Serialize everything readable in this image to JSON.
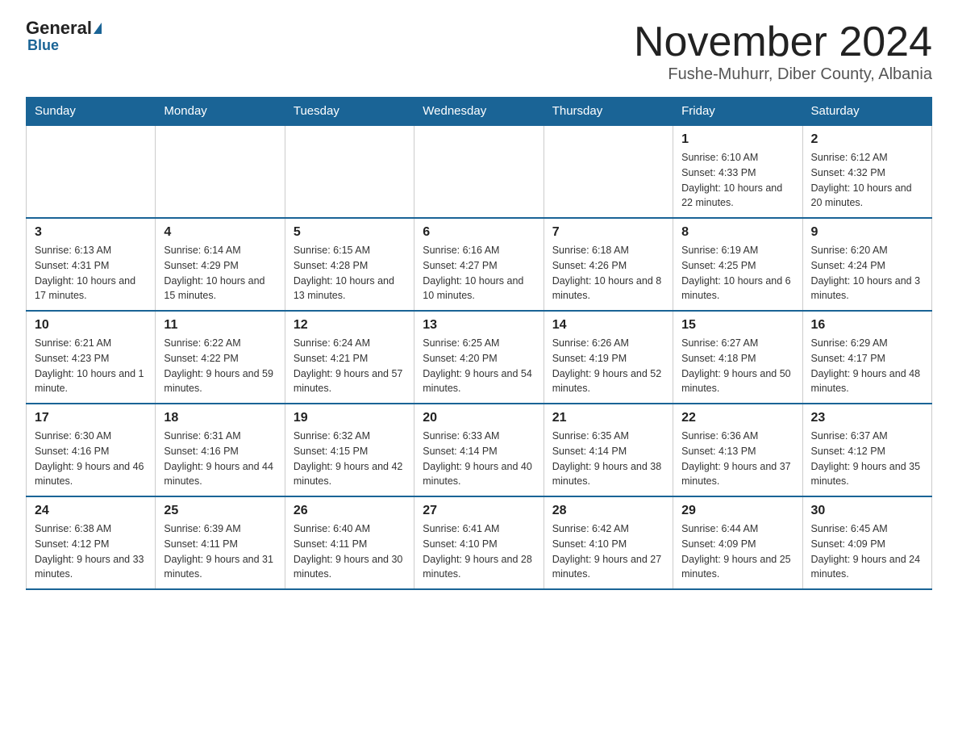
{
  "logo": {
    "general": "General",
    "blue": "Blue"
  },
  "header": {
    "month": "November 2024",
    "location": "Fushe-Muhurr, Diber County, Albania"
  },
  "weekdays": [
    "Sunday",
    "Monday",
    "Tuesday",
    "Wednesday",
    "Thursday",
    "Friday",
    "Saturday"
  ],
  "weeks": [
    [
      {
        "day": "",
        "info": ""
      },
      {
        "day": "",
        "info": ""
      },
      {
        "day": "",
        "info": ""
      },
      {
        "day": "",
        "info": ""
      },
      {
        "day": "",
        "info": ""
      },
      {
        "day": "1",
        "info": "Sunrise: 6:10 AM\nSunset: 4:33 PM\nDaylight: 10 hours and 22 minutes."
      },
      {
        "day": "2",
        "info": "Sunrise: 6:12 AM\nSunset: 4:32 PM\nDaylight: 10 hours and 20 minutes."
      }
    ],
    [
      {
        "day": "3",
        "info": "Sunrise: 6:13 AM\nSunset: 4:31 PM\nDaylight: 10 hours and 17 minutes."
      },
      {
        "day": "4",
        "info": "Sunrise: 6:14 AM\nSunset: 4:29 PM\nDaylight: 10 hours and 15 minutes."
      },
      {
        "day": "5",
        "info": "Sunrise: 6:15 AM\nSunset: 4:28 PM\nDaylight: 10 hours and 13 minutes."
      },
      {
        "day": "6",
        "info": "Sunrise: 6:16 AM\nSunset: 4:27 PM\nDaylight: 10 hours and 10 minutes."
      },
      {
        "day": "7",
        "info": "Sunrise: 6:18 AM\nSunset: 4:26 PM\nDaylight: 10 hours and 8 minutes."
      },
      {
        "day": "8",
        "info": "Sunrise: 6:19 AM\nSunset: 4:25 PM\nDaylight: 10 hours and 6 minutes."
      },
      {
        "day": "9",
        "info": "Sunrise: 6:20 AM\nSunset: 4:24 PM\nDaylight: 10 hours and 3 minutes."
      }
    ],
    [
      {
        "day": "10",
        "info": "Sunrise: 6:21 AM\nSunset: 4:23 PM\nDaylight: 10 hours and 1 minute."
      },
      {
        "day": "11",
        "info": "Sunrise: 6:22 AM\nSunset: 4:22 PM\nDaylight: 9 hours and 59 minutes."
      },
      {
        "day": "12",
        "info": "Sunrise: 6:24 AM\nSunset: 4:21 PM\nDaylight: 9 hours and 57 minutes."
      },
      {
        "day": "13",
        "info": "Sunrise: 6:25 AM\nSunset: 4:20 PM\nDaylight: 9 hours and 54 minutes."
      },
      {
        "day": "14",
        "info": "Sunrise: 6:26 AM\nSunset: 4:19 PM\nDaylight: 9 hours and 52 minutes."
      },
      {
        "day": "15",
        "info": "Sunrise: 6:27 AM\nSunset: 4:18 PM\nDaylight: 9 hours and 50 minutes."
      },
      {
        "day": "16",
        "info": "Sunrise: 6:29 AM\nSunset: 4:17 PM\nDaylight: 9 hours and 48 minutes."
      }
    ],
    [
      {
        "day": "17",
        "info": "Sunrise: 6:30 AM\nSunset: 4:16 PM\nDaylight: 9 hours and 46 minutes."
      },
      {
        "day": "18",
        "info": "Sunrise: 6:31 AM\nSunset: 4:16 PM\nDaylight: 9 hours and 44 minutes."
      },
      {
        "day": "19",
        "info": "Sunrise: 6:32 AM\nSunset: 4:15 PM\nDaylight: 9 hours and 42 minutes."
      },
      {
        "day": "20",
        "info": "Sunrise: 6:33 AM\nSunset: 4:14 PM\nDaylight: 9 hours and 40 minutes."
      },
      {
        "day": "21",
        "info": "Sunrise: 6:35 AM\nSunset: 4:14 PM\nDaylight: 9 hours and 38 minutes."
      },
      {
        "day": "22",
        "info": "Sunrise: 6:36 AM\nSunset: 4:13 PM\nDaylight: 9 hours and 37 minutes."
      },
      {
        "day": "23",
        "info": "Sunrise: 6:37 AM\nSunset: 4:12 PM\nDaylight: 9 hours and 35 minutes."
      }
    ],
    [
      {
        "day": "24",
        "info": "Sunrise: 6:38 AM\nSunset: 4:12 PM\nDaylight: 9 hours and 33 minutes."
      },
      {
        "day": "25",
        "info": "Sunrise: 6:39 AM\nSunset: 4:11 PM\nDaylight: 9 hours and 31 minutes."
      },
      {
        "day": "26",
        "info": "Sunrise: 6:40 AM\nSunset: 4:11 PM\nDaylight: 9 hours and 30 minutes."
      },
      {
        "day": "27",
        "info": "Sunrise: 6:41 AM\nSunset: 4:10 PM\nDaylight: 9 hours and 28 minutes."
      },
      {
        "day": "28",
        "info": "Sunrise: 6:42 AM\nSunset: 4:10 PM\nDaylight: 9 hours and 27 minutes."
      },
      {
        "day": "29",
        "info": "Sunrise: 6:44 AM\nSunset: 4:09 PM\nDaylight: 9 hours and 25 minutes."
      },
      {
        "day": "30",
        "info": "Sunrise: 6:45 AM\nSunset: 4:09 PM\nDaylight: 9 hours and 24 minutes."
      }
    ]
  ]
}
